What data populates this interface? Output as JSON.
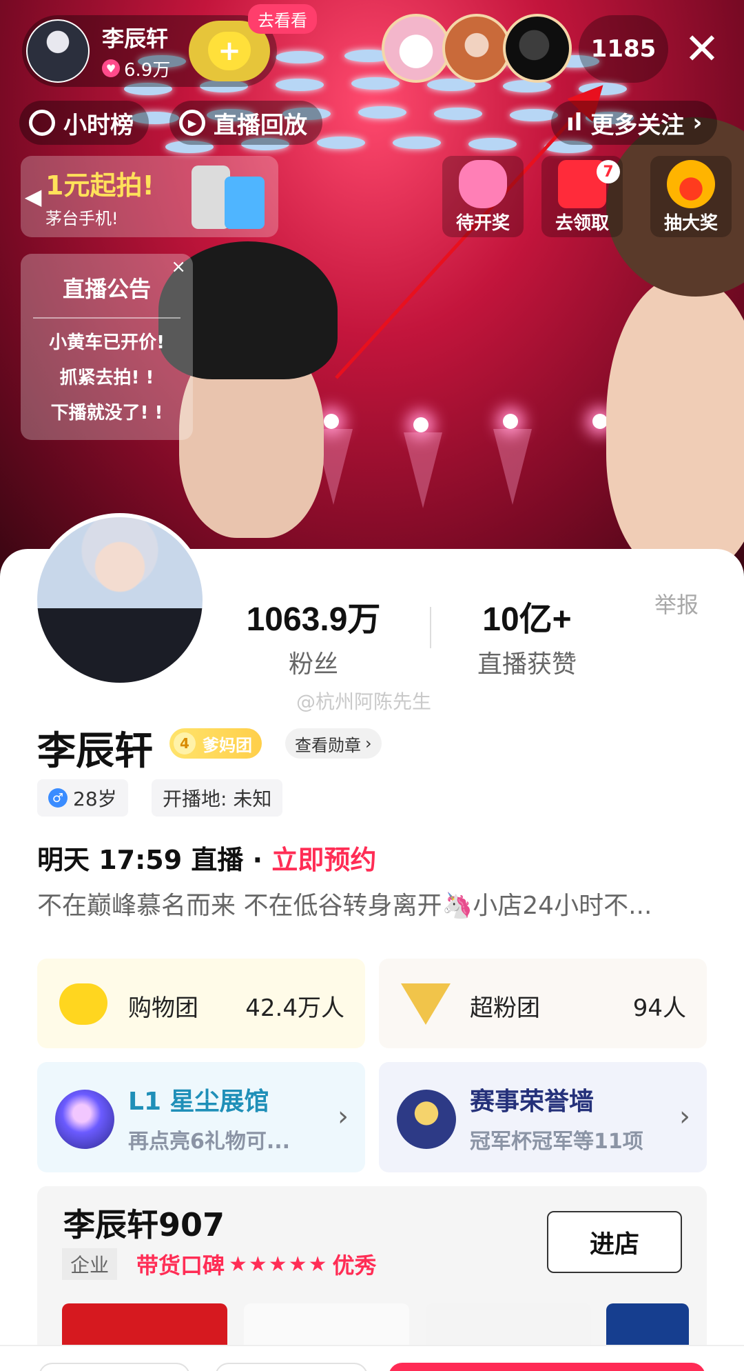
{
  "host": {
    "name": "李辰轩",
    "likes": "6.9万",
    "follow_plus": "+",
    "go_see_label": "去看看"
  },
  "viewers": {
    "count": "1185"
  },
  "top_chips": {
    "hourly": "小时榜",
    "replay": "直播回放",
    "more_follow": "更多关注"
  },
  "promo": {
    "title": "1元起拍!",
    "subtitle": "茅台手机!"
  },
  "activities": [
    {
      "label": "待开奖",
      "icon": "lucky-bag-icon"
    },
    {
      "label": "去领取",
      "icon": "red-packet-icon",
      "badge": "7"
    },
    {
      "label": "抽大奖",
      "icon": "fire-drop-icon"
    }
  ],
  "notice": {
    "title": "直播公告",
    "lines": [
      "小黄车已开价!",
      "抓紧去拍! !",
      "下播就没了! !"
    ]
  },
  "profile": {
    "fans_value": "1063.9万",
    "fans_label": "粉丝",
    "likes_value": "10亿+",
    "likes_label": "直播获赞",
    "report": "举报",
    "watermark": "@杭州阿陈先生",
    "name": "李辰轩",
    "fan_level": "4",
    "fan_group": "爹妈团",
    "medal_btn": "查看勋章",
    "age": "28岁",
    "location": "开播地: 未知",
    "schedule_time": "明天 17:59 直播 · ",
    "schedule_action": "立即预约",
    "bio": "不在巅峰慕名而来 不在低谷转身离开🦄小店24小时不..."
  },
  "cards": {
    "shop_group": {
      "label": "购物团",
      "count": "42.4万人"
    },
    "super_fans": {
      "label": "超粉团",
      "count": "94人"
    },
    "gallery": {
      "title": "L1 星尘展馆",
      "subtitle": "再点亮6礼物可..."
    },
    "honor": {
      "title": "赛事荣誉墙",
      "subtitle": "冠军杯冠军等11项"
    }
  },
  "shop": {
    "name": "李辰轩907",
    "type": "企业",
    "rating_label": "带货口碑",
    "stars": "★★★★★",
    "rating_level": "优秀",
    "rating_value": 4.5,
    "enter_label": "进店"
  },
  "colors": {
    "accent": "#ff2d55",
    "gold": "#ffd61f",
    "arrow": "#e8101e"
  }
}
